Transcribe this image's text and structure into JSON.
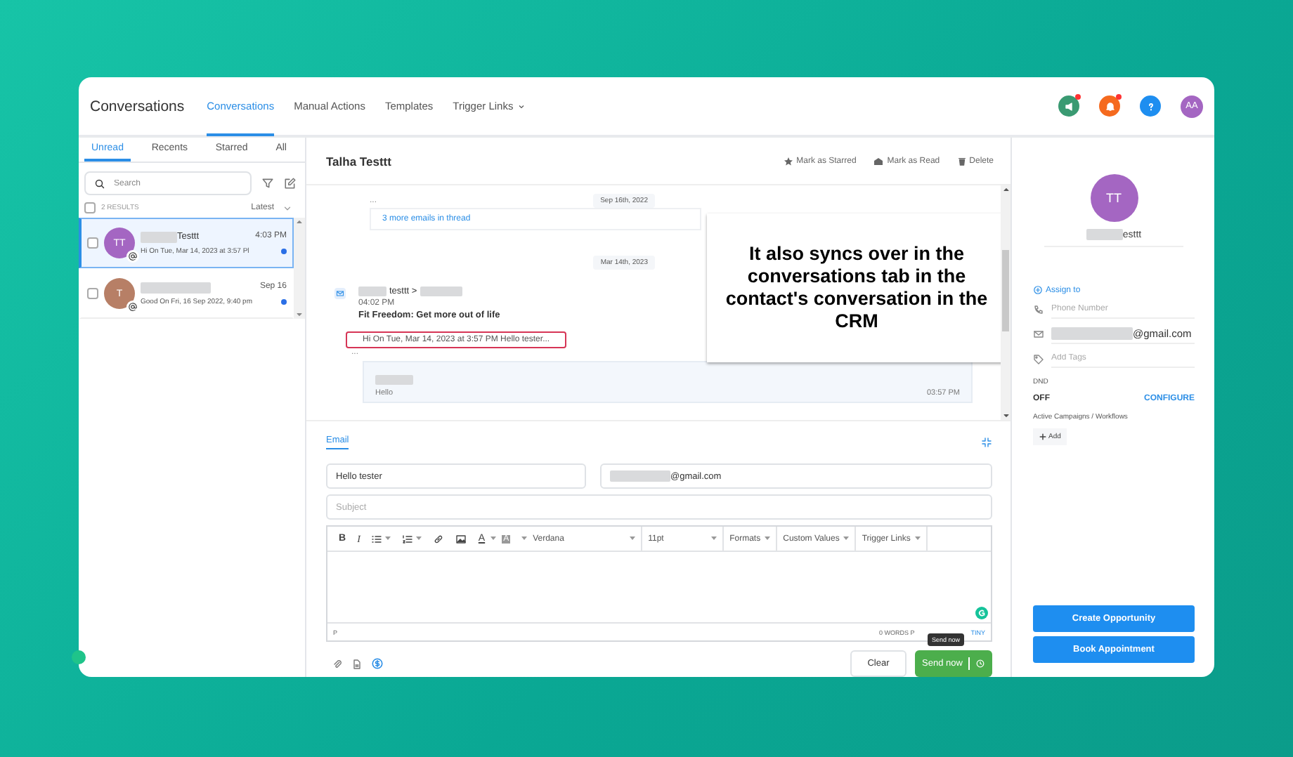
{
  "header": {
    "title": "Conversations",
    "tabs": [
      {
        "label": "Conversations",
        "selected": true,
        "dropdown": false
      },
      {
        "label": "Manual Actions",
        "selected": false,
        "dropdown": false
      },
      {
        "label": "Templates",
        "selected": false,
        "dropdown": false
      },
      {
        "label": "Trigger Links",
        "selected": false,
        "dropdown": true
      }
    ],
    "icons": [
      {
        "kind": "megaphone",
        "color": "#3a9a72",
        "badge": true
      },
      {
        "kind": "bell",
        "color": "#f56a1e",
        "badge": true
      },
      {
        "kind": "help",
        "color": "#1e8ef0",
        "badge": false
      }
    ],
    "avatar": "AA"
  },
  "sidebar": {
    "tabs": [
      {
        "label": "Unread",
        "selected": true
      },
      {
        "label": "Recents",
        "selected": false
      },
      {
        "label": "Starred",
        "selected": false
      },
      {
        "label": "All",
        "selected": false
      }
    ],
    "search": {
      "placeholder": "Search"
    },
    "select_all_checked": false,
    "results": "2 RESULTS",
    "sort": "Latest",
    "items": [
      {
        "initials": "TT",
        "color": "#a466c2",
        "name": "Testtt",
        "preview": "Hi On Tue, Mar 14, 2023 at 3:57 Pl",
        "time": "4:03 PM",
        "selected": true,
        "unread": true,
        "checked": false
      },
      {
        "initials": "T",
        "color": "#b77f66",
        "preview": "Good On Fri, 16 Sep 2022, 9:40 pm",
        "time": "Sep 16",
        "selected": false,
        "unread": true,
        "checked": false
      }
    ]
  },
  "thread": {
    "contact": "Talha Testtt",
    "actions": [
      {
        "kind": "star",
        "label": "Mark as Starred"
      },
      {
        "kind": "read",
        "label": "Mark as Read"
      },
      {
        "kind": "delete",
        "label": "Delete"
      }
    ],
    "earlier": {
      "ellipsis": "...",
      "date": "Sep 16th, 2022",
      "more": "3 more emails in thread"
    },
    "message": {
      "date": "Mar 14th, 2023",
      "sender": "testtt >",
      "time": "04:02 PM",
      "subject": "Fit Freedom: Get more out of life",
      "preview": "Hi On Tue, Mar 14, 2023 at 3:57 PM Hello tester...",
      "ellipsis": "...",
      "reply": {
        "text": "Hello",
        "time": "03:57 PM"
      }
    }
  },
  "callout": "It also syncs over in the conversations tab in the contact's conversation in the CRM",
  "composer": {
    "tab": "Email",
    "name": "Hello tester",
    "email": "@gmail.com",
    "subject_placeholder": "Subject",
    "toolbar": {
      "bold": "B",
      "italic": "I",
      "text_color": "A",
      "highlight": "A",
      "font": "Verdana",
      "size": "11pt",
      "menus": [
        "Formats",
        "Custom Values",
        "Trigger Links"
      ]
    },
    "path": "P",
    "words": "0 WORDS P",
    "brand": "TINY",
    "tooltip": "Send now",
    "clear": "Clear",
    "send": "Send now"
  },
  "contact": {
    "initials": "TT",
    "color": "#a466c2",
    "name": "esttt",
    "assign": "Assign to",
    "phone_placeholder": "Phone Number",
    "email": "@gmail.com",
    "tags_placeholder": "Add Tags",
    "dnd_label": "DND",
    "dnd_value": "OFF",
    "configure": "CONFIGURE",
    "campaigns_label": "Active Campaigns / Workflows",
    "add": "Add",
    "buttons": [
      "Create Opportunity",
      "Book Appointment"
    ]
  }
}
